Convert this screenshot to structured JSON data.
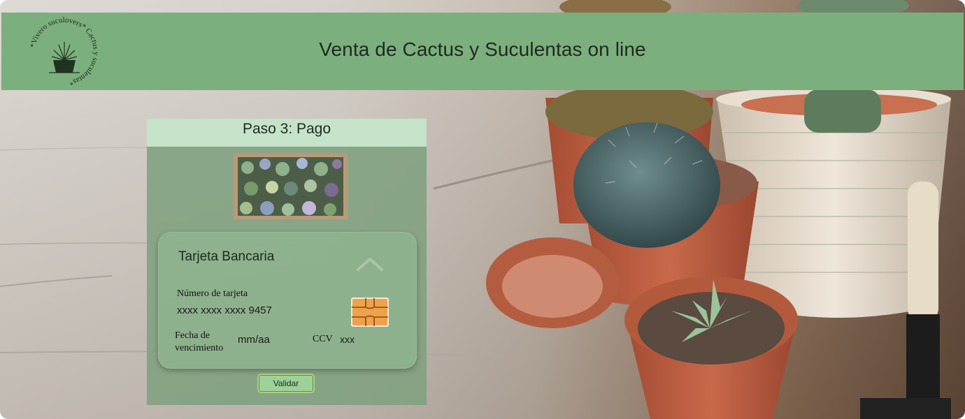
{
  "header": {
    "title": "Venta de Cactus y Suculentas on line",
    "logo_text": "Vivero suculovers* Cactus y suculentas*",
    "background_color": "#7caf7e"
  },
  "payment": {
    "step_title": "Paso 3: Pago",
    "product_image_icon": "succulents-tray-image",
    "card": {
      "title": "Tarjeta Bancaria",
      "number_label": "Número de tarjeta",
      "number_value": "xxxx xxxx xxxx 9457",
      "expiry_label_line1": "Fecha de",
      "expiry_label_line2": "vencimiento",
      "expiry_value": "mm/aa",
      "ccv_label": "CCV",
      "ccv_value": "xxx",
      "chip_icon": "card-chip-icon",
      "collapse_icon": "chevron-up-icon"
    },
    "validate_label": "Validar"
  }
}
